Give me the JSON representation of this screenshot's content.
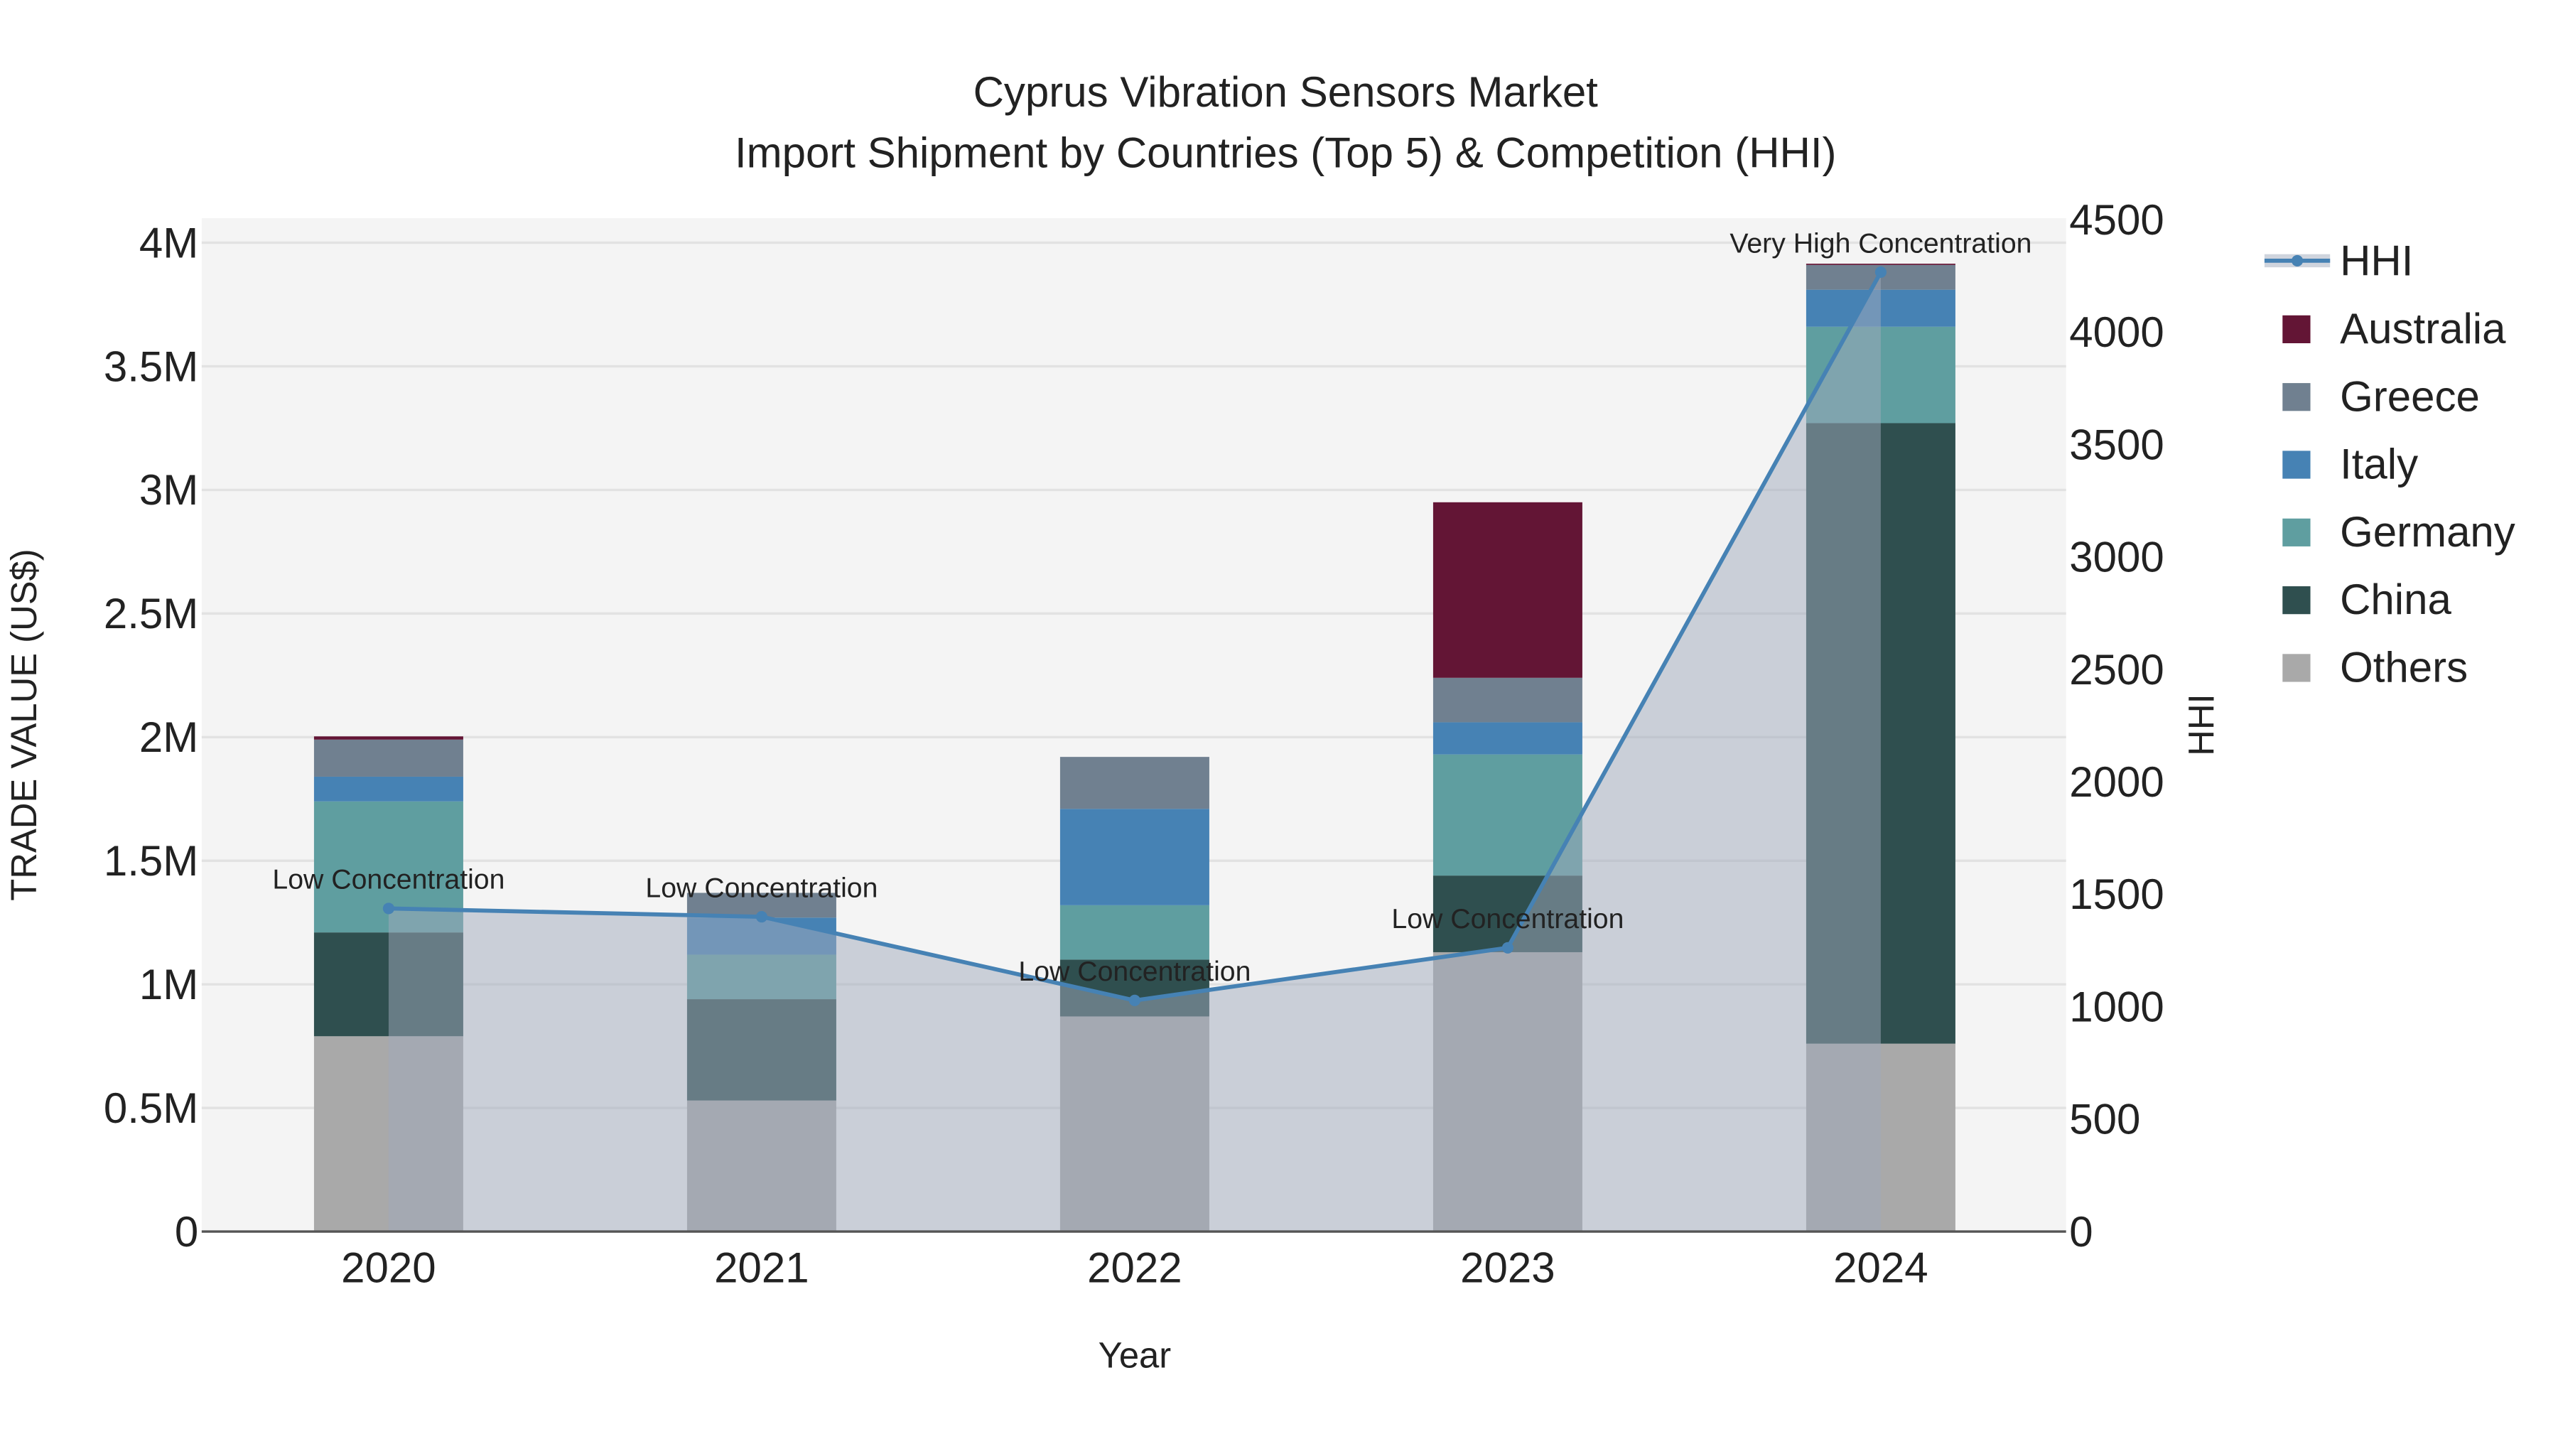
{
  "chart_data": {
    "type": "bar",
    "stacked": true,
    "title": "Cyprus Vibration Sensors Market",
    "subtitle": "Import Shipment by Countries (Top 5) & Competition (HHI)",
    "xlabel": "Year",
    "ylabel": "TRADE VALUE (US$)",
    "y2label": "HHI",
    "categories": [
      "2020",
      "2021",
      "2022",
      "2023",
      "2024"
    ],
    "ylim": [
      0,
      4100000
    ],
    "y2lim": [
      0,
      4560
    ],
    "yticks": [
      {
        "v": 0,
        "label": "0"
      },
      {
        "v": 500000,
        "label": "0.5M"
      },
      {
        "v": 1000000,
        "label": "1M"
      },
      {
        "v": 1500000,
        "label": "1.5M"
      },
      {
        "v": 2000000,
        "label": "2M"
      },
      {
        "v": 2500000,
        "label": "2.5M"
      },
      {
        "v": 3000000,
        "label": "3M"
      },
      {
        "v": 3500000,
        "label": "3.5M"
      },
      {
        "v": 4000000,
        "label": "4M"
      }
    ],
    "y2ticks": [
      0,
      500,
      1000,
      1500,
      2000,
      2500,
      3000,
      3500,
      4000,
      4500
    ],
    "series": [
      {
        "name": "Others",
        "color": "#A9A9A9",
        "values": [
          790000,
          530000,
          870000,
          1130000,
          760000
        ]
      },
      {
        "name": "China",
        "color": "#2F4F4F",
        "values": [
          420000,
          410000,
          230000,
          310000,
          2510000
        ]
      },
      {
        "name": "Germany",
        "color": "#5F9EA0",
        "values": [
          530000,
          180000,
          220000,
          490000,
          390000
        ]
      },
      {
        "name": "Italy",
        "color": "#4682B4",
        "values": [
          100000,
          150000,
          390000,
          130000,
          150000
        ]
      },
      {
        "name": "Greece",
        "color": "#708090",
        "values": [
          150000,
          100000,
          210000,
          180000,
          100000
        ]
      },
      {
        "name": "Australia",
        "color": "#631535",
        "values": [
          13000,
          0,
          0,
          710000,
          5000
        ]
      }
    ],
    "hhi": {
      "name": "HHI",
      "color": "#4682B4",
      "values": [
        1437,
        1400,
        1028,
        1262,
        4267
      ],
      "annotations": [
        "Low Concentration",
        "Low Concentration",
        "Low Concentration",
        "Low Concentration",
        "Very High Concentration"
      ]
    },
    "legend": [
      "HHI",
      "Australia",
      "Greece",
      "Italy",
      "Germany",
      "China",
      "Others"
    ],
    "legend_placement": "right",
    "grid": true
  }
}
